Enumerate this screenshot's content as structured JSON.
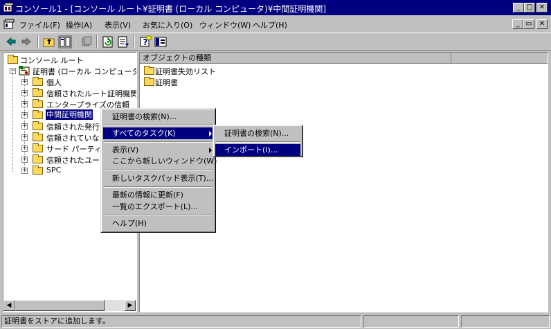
{
  "window": {
    "title": "コンソール1 - [コンソール ルート¥証明書 (ローカル コンピュータ)¥中間証明機関]",
    "minimize": "_",
    "maximize": "□",
    "close": "✕",
    "child_minimize": "_",
    "child_restore": "▭",
    "child_close": "✕"
  },
  "menubar": {
    "items": [
      "ファイル(F)",
      "操作(A)",
      "表示(V)",
      "お気に入り(O)",
      "ウィンドウ(W)",
      "ヘルプ(H)"
    ]
  },
  "tree": {
    "root": "コンソール ルート",
    "cert_store": "証明書 (ローカル コンピュータ)",
    "items": [
      "個人",
      "信頼されたルート証明機関",
      "エンタープライズの信頼",
      "中間証明機関",
      "信頼された発行",
      "信頼されていな",
      "サード パーティ",
      "信頼されたユー",
      "SPC"
    ]
  },
  "list": {
    "column_header": "オブジェクトの種類",
    "items": [
      "証明書失効リスト",
      "証明書"
    ]
  },
  "context_menu": {
    "items": {
      "find": "証明書の検索(N)...",
      "all_tasks": "すべてのタスク(K)",
      "view": "表示(V)",
      "new_window": "ここから新しいウィンドウ(W)",
      "new_taskpad": "新しいタスクパッド表示(T)...",
      "refresh": "最新の情報に更新(F)",
      "export_list": "一覧のエクスポート(L)...",
      "help": "ヘルプ(H)"
    }
  },
  "submenu": {
    "items": {
      "find": "証明書の検索(N)...",
      "import": "インポート(I)..."
    }
  },
  "statusbar": {
    "text": "証明書をストアに追加します。"
  },
  "colors": {
    "titlebar": "#000080",
    "face": "#c0c0c0",
    "highlight": "#000080"
  }
}
